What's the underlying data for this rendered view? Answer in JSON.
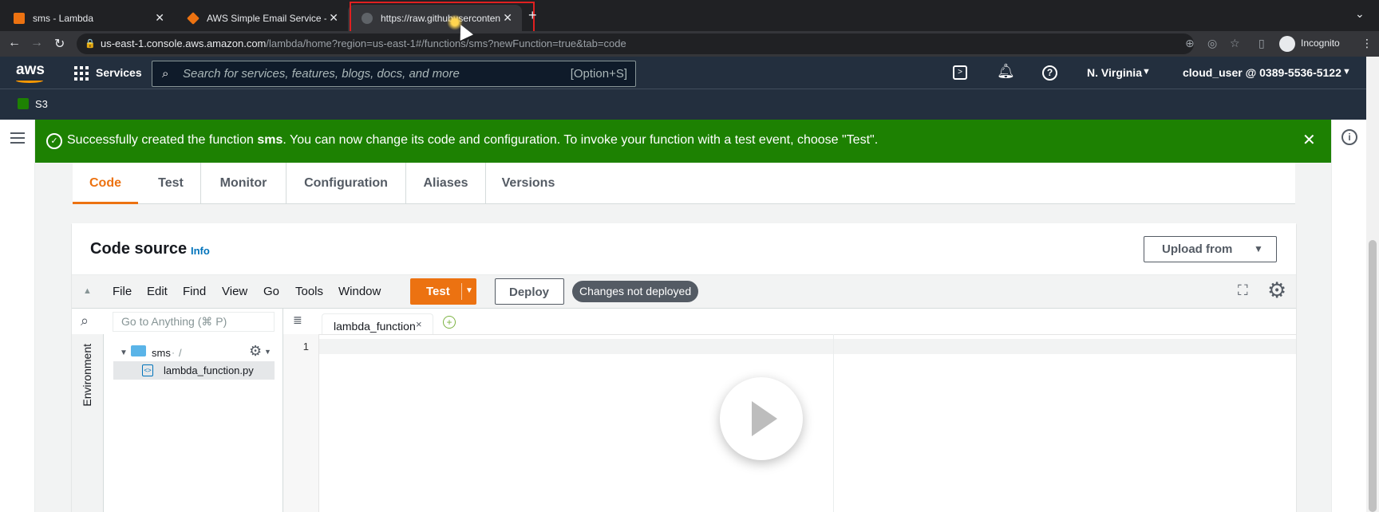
{
  "browser": {
    "tabs": [
      {
        "title": "sms - Lambda",
        "favicon_color": "#ec7211"
      },
      {
        "title": "AWS Simple Email Service - De",
        "favicon_color": "#ec7211"
      },
      {
        "title": "https://raw.githubusercontent.c",
        "favicon_color": "#9aa0a6"
      }
    ],
    "url_host": "us-east-1.console.aws.amazon.com",
    "url_path": "/lambda/home?region=us-east-1#/functions/sms?newFunction=true&tab=code",
    "profile": "Incognito"
  },
  "aws_header": {
    "logo": "aws",
    "services": "Services",
    "search_placeholder": "Search for services, features, blogs, docs, and more",
    "search_shortcut": "[Option+S]",
    "region": "N. Virginia",
    "account": "cloud_user @ 0389-5536-5122",
    "favorite": "S3"
  },
  "flash": {
    "prefix": "Successfully created the function ",
    "function_name": "sms",
    "suffix": ". You can now change its code and configuration. To invoke your function with a test event, choose \"Test\".",
    "color": "#1d8102"
  },
  "page_tabs": [
    "Code",
    "Test",
    "Monitor",
    "Configuration",
    "Aliases",
    "Versions"
  ],
  "code_source": {
    "title": "Code source",
    "info": "Info",
    "upload": "Upload from",
    "menus": [
      "File",
      "Edit",
      "Find",
      "View",
      "Go",
      "Tools",
      "Window"
    ],
    "test_button": "Test",
    "deploy_button": "Deploy",
    "status": "Changes not deployed",
    "goto_placeholder": "Go to Anything (⌘ P)",
    "environment": "Environment",
    "folder": "sms",
    "folder_path": "/",
    "file": "lambda_function.py",
    "editor_tab": "lambda_function",
    "line_number": "1"
  }
}
